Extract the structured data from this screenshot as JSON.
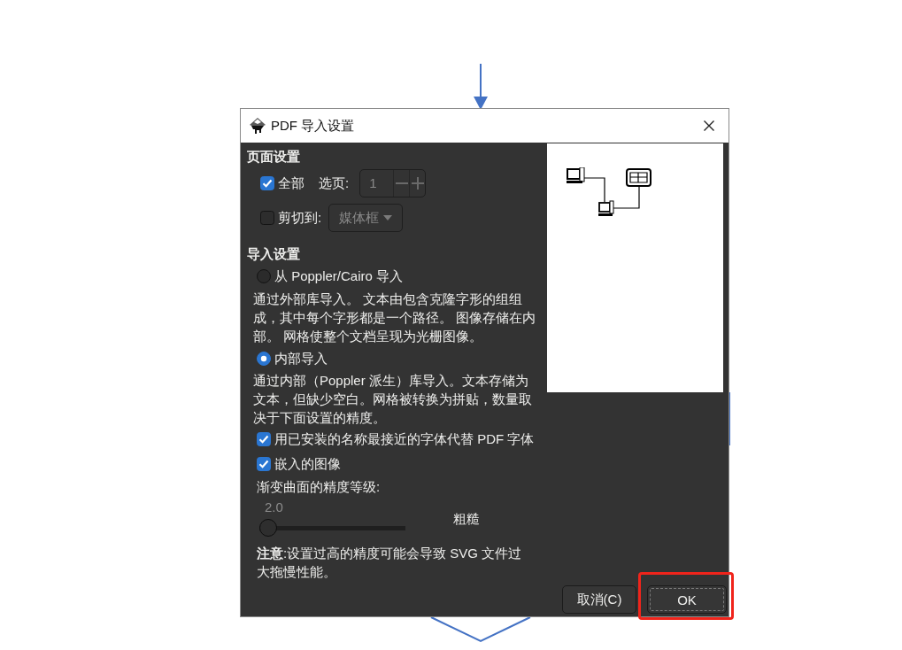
{
  "window": {
    "title": "PDF 导入设置"
  },
  "page_settings": {
    "heading": "页面设置",
    "all_pages": {
      "label": "全部",
      "checked": true
    },
    "page_select": {
      "label": "选页:",
      "value": "1",
      "disabled": true
    },
    "clip_to": {
      "label": "剪切到:",
      "checked": false,
      "value": "媒体框",
      "disabled": true
    }
  },
  "import_settings": {
    "heading": "导入设置",
    "methods": [
      {
        "label": "从 Poppler/Cairo 导入",
        "selected": false,
        "description": "通过外部库导入。 文本由包含克隆字形的组组成，其中每个字形都是一个路径。 图像存储在内部。 网格使整个文档呈现为光栅图像。"
      },
      {
        "label": "内部导入",
        "selected": true,
        "description": "通过内部（Poppler 派生）库导入。文本存储为文本，但缺少空白。网格被转换为拼贴，数量取决于下面设置的精度。"
      }
    ],
    "options": [
      {
        "label": "用已安装的名称最接近的字体代替 PDF 字体",
        "checked": true
      },
      {
        "label": "嵌入的图像",
        "checked": true
      }
    ],
    "precision": {
      "label": "渐变曲面的精度等级:",
      "value": "2.0",
      "level": 0,
      "quality": "粗糙"
    },
    "note": "**注意**:设置过高的精度可能会导致 SVG 文件过大拖慢性能。"
  },
  "buttons": [
    {
      "label": "取消(C)",
      "focused": false,
      "highlighted": false
    },
    {
      "label": "OK",
      "focused": true,
      "highlighted": true
    }
  ]
}
